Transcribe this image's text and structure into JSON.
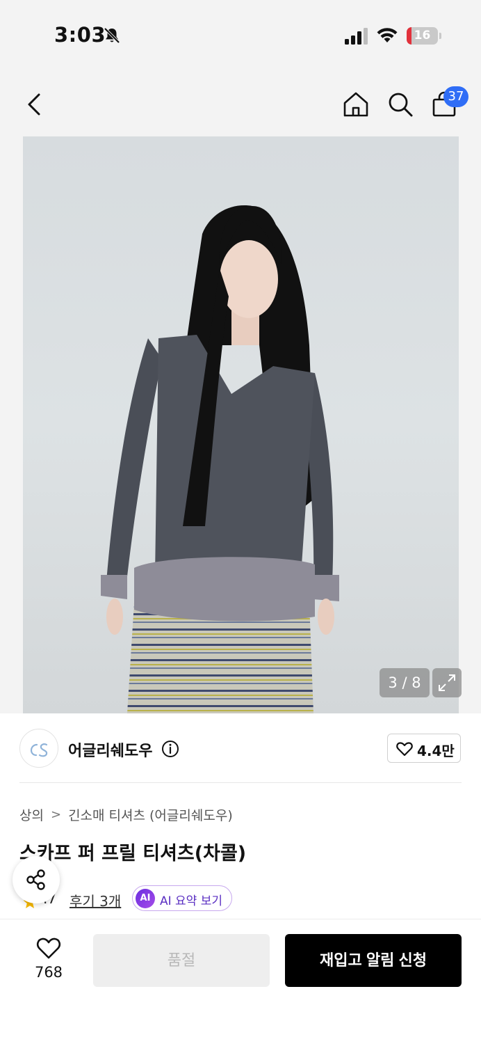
{
  "status_bar": {
    "time": "3:03",
    "battery_level": "16",
    "battery_fraction": 0.16,
    "icons": [
      "bell-slash-icon",
      "cellular-signal-icon",
      "wifi-icon",
      "battery-icon"
    ]
  },
  "nav": {
    "cart_count": "37",
    "icons": [
      "back-chevron-icon",
      "home-icon",
      "search-icon",
      "shopping-bag-icon"
    ]
  },
  "gallery": {
    "counter": "3 / 8",
    "current": 3,
    "total": 8,
    "icons": [
      "expand-icon"
    ]
  },
  "store": {
    "logo_text": "ꞩ",
    "name": "어글리쉐도우",
    "likes": "4.4만",
    "icons": [
      "info-circle-icon",
      "heart-outline-icon"
    ]
  },
  "product": {
    "breadcrumb": [
      "상의",
      "긴소매 티셔츠 (어글리쉐도우)"
    ],
    "breadcrumb_separator": ">",
    "title": "스카프 퍼 프릴 티셔츠(차콜)",
    "rating": ".7",
    "reviews": "후기 3개",
    "ai_badge": "AI",
    "ai_label": "AI 요약 보기"
  },
  "bottom_bar": {
    "wish_count": "768",
    "soldout_label": "품절",
    "restock_label": "재입고 알림 신청"
  },
  "colors": {
    "accent_blue": "#2f6df6",
    "battery_red": "#e2313b",
    "ai_purple": "#6a2be0",
    "primary_button": "#000000",
    "disabled_button": "#eeeeee",
    "star": "#f6b800"
  }
}
